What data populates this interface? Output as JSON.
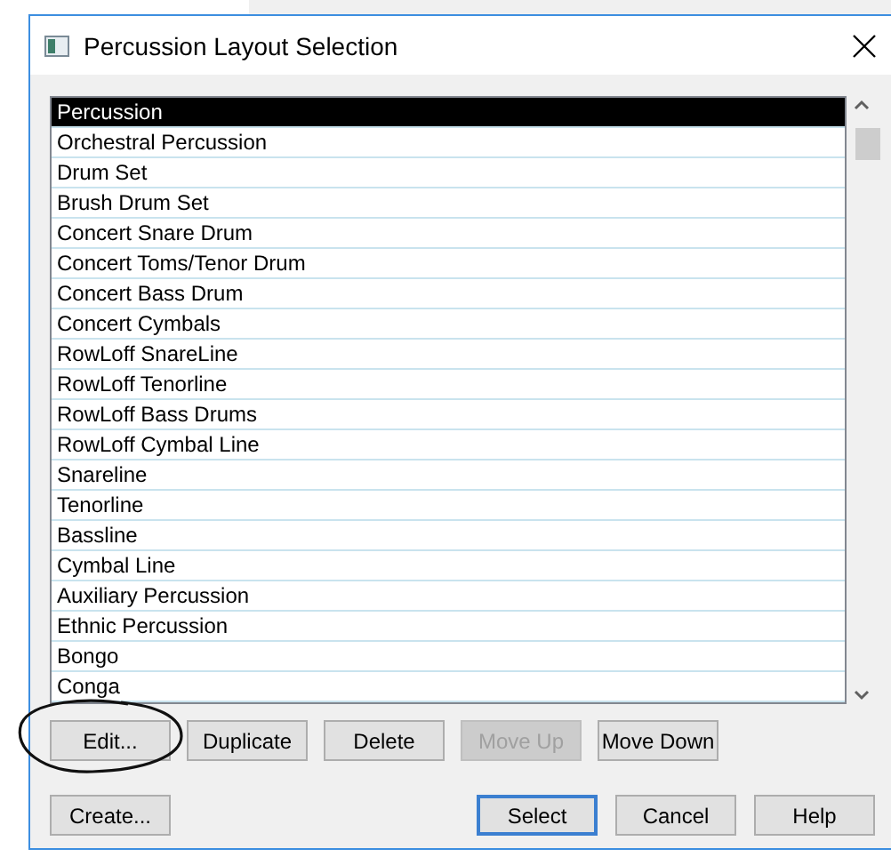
{
  "window": {
    "title": "Percussion Layout Selection"
  },
  "layouts": [
    {
      "label": "Percussion",
      "selected": true
    },
    {
      "label": "Orchestral Percussion",
      "selected": false
    },
    {
      "label": "Drum Set",
      "selected": false
    },
    {
      "label": "Brush Drum Set",
      "selected": false
    },
    {
      "label": "Concert Snare Drum",
      "selected": false
    },
    {
      "label": "Concert Toms/Tenor Drum",
      "selected": false
    },
    {
      "label": "Concert Bass Drum",
      "selected": false
    },
    {
      "label": "Concert Cymbals",
      "selected": false
    },
    {
      "label": "RowLoff SnareLine",
      "selected": false
    },
    {
      "label": "RowLoff Tenorline",
      "selected": false
    },
    {
      "label": "RowLoff Bass Drums",
      "selected": false
    },
    {
      "label": "RowLoff Cymbal Line",
      "selected": false
    },
    {
      "label": "Snareline",
      "selected": false
    },
    {
      "label": "Tenorline",
      "selected": false
    },
    {
      "label": "Bassline",
      "selected": false
    },
    {
      "label": "Cymbal Line",
      "selected": false
    },
    {
      "label": "Auxiliary Percussion",
      "selected": false
    },
    {
      "label": "Ethnic Percussion",
      "selected": false
    },
    {
      "label": "Bongo",
      "selected": false
    },
    {
      "label": "Conga",
      "selected": false
    }
  ],
  "list_buttons": [
    {
      "label": "Edit...",
      "disabled": false,
      "circled": true
    },
    {
      "label": "Duplicate",
      "disabled": false,
      "circled": false
    },
    {
      "label": "Delete",
      "disabled": false,
      "circled": false
    },
    {
      "label": "Move Up",
      "disabled": true,
      "circled": false
    },
    {
      "label": "Move Down",
      "disabled": false,
      "circled": false
    }
  ],
  "create_button": {
    "label": "Create..."
  },
  "dialog_buttons": [
    {
      "label": "Select",
      "default": true
    },
    {
      "label": "Cancel",
      "default": false
    },
    {
      "label": "Help",
      "default": false
    }
  ]
}
